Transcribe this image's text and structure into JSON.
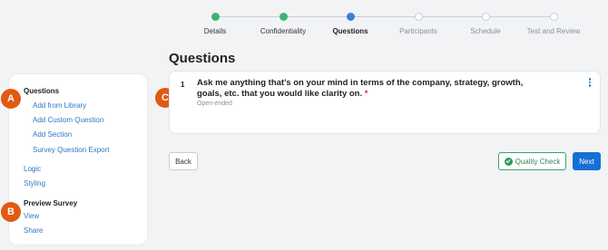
{
  "stepper": {
    "steps": [
      {
        "label": "Details",
        "state": "done"
      },
      {
        "label": "Confidentiality",
        "state": "done"
      },
      {
        "label": "Questions",
        "state": "active"
      },
      {
        "label": "Participants",
        "state": "todo"
      },
      {
        "label": "Schedule",
        "state": "todo"
      },
      {
        "label": "Test and Review",
        "state": "todo"
      }
    ]
  },
  "page": {
    "title": "Questions"
  },
  "sidebar": {
    "questions_heading": "Questions",
    "add_from_library": "Add from Library",
    "add_custom_question": "Add Custom Question",
    "add_section": "Add Section",
    "survey_question_export": "Survey Question Export",
    "logic": "Logic",
    "styling": "Styling",
    "preview_heading": "Preview Survey",
    "view": "View",
    "share": "Share"
  },
  "badges": {
    "a": "A",
    "b": "B",
    "c": "C"
  },
  "question": {
    "number": "1",
    "text": "Ask me anything that's on your mind in terms of the company, strategy, growth, goals, etc. that you would like clarity on.",
    "required_marker": "*",
    "type": "Open-ended"
  },
  "buttons": {
    "back": "Back",
    "quality_check": "Quality Check",
    "next": "Next"
  },
  "colors": {
    "done": "#3cb371",
    "active": "#3d7fd9",
    "link": "#2f79c6",
    "badge": "#e05a12",
    "primary": "#1670d4"
  }
}
